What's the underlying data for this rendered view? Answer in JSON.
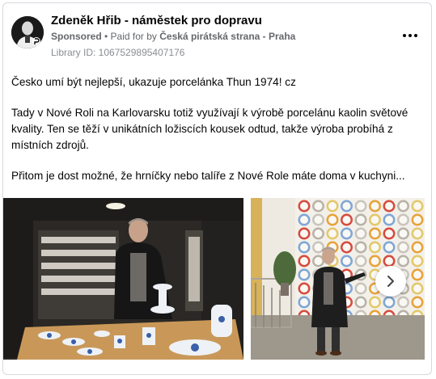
{
  "post": {
    "author": "Zdeněk Hřib - náměstek pro dopravu",
    "sponsored": "Sponsored",
    "paid_for_prefix": " • Paid for by ",
    "advertiser": "Česká pirátská strana - Praha",
    "library_id": "Library ID: 1067529895407176",
    "paragraphs": [
      "Česko umí být nejlepší, ukazuje porcelánka Thun 1974! cz",
      "Tady v Nové Roli na Karlovarsku totiž využívají k výrobě porcelánu kaolin světové kvality. Ten se těží v unikátních ložiscích kousek odtud, takže výroba probíhá z místních zdrojů.",
      "Přitom je dost možné, že hrníčky nebo talíře z Nové Role máte doma v kuchyni..."
    ]
  },
  "icons": {
    "more": "more-options-icon",
    "next": "chevron-right-icon"
  },
  "colors": {
    "secondary_text": "#65676b",
    "border": "#d6d9dd"
  }
}
